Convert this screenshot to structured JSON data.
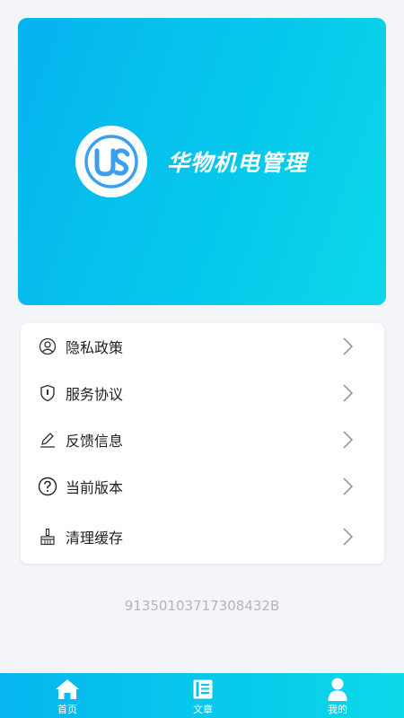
{
  "banner": {
    "logo_icon": "hw-logo-icon",
    "title": "华物机电管理"
  },
  "menu": {
    "items": [
      {
        "label": "隐私政策",
        "icon": "user-circle-icon"
      },
      {
        "label": "服务协议",
        "icon": "shield-icon"
      },
      {
        "label": "反馈信息",
        "icon": "edit-icon"
      },
      {
        "label": "当前版本",
        "icon": "question-circle-icon"
      },
      {
        "label": "清理缓存",
        "icon": "broom-icon"
      }
    ]
  },
  "footer_code": "91350103717308432B",
  "tabbar": {
    "tabs": [
      {
        "label": "首页",
        "icon": "home-icon"
      },
      {
        "label": "文章",
        "icon": "article-icon"
      },
      {
        "label": "我的",
        "icon": "person-icon"
      }
    ]
  },
  "colors": {
    "accent_start": "#05b3ee",
    "accent_end": "#0bd8e9",
    "background": "#f4f5f8"
  }
}
